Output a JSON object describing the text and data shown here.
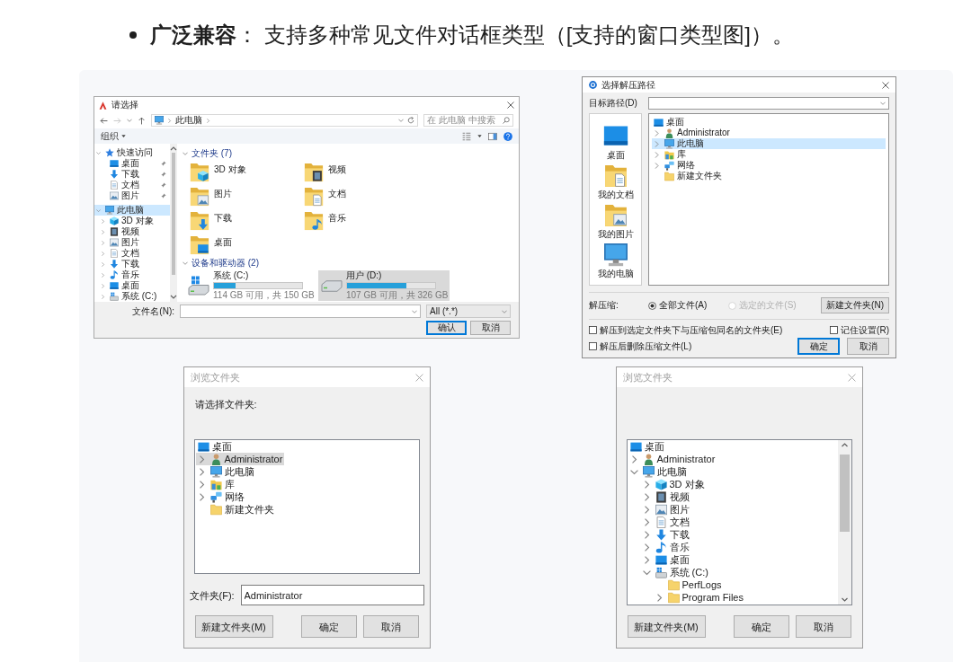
{
  "heading": "**广泛兼容**： 支持多种常见文件对话框类型（[支持的窗口类型图]）。",
  "file_dialog": {
    "title": "请选择",
    "active": true,
    "address": {
      "path": "此电脑"
    },
    "search": {
      "placeholder": "在 此电脑 中搜索"
    },
    "toolbar": {
      "organize": "组织"
    },
    "navigation": [
      {
        "label": "快速访问",
        "kind": "quickaccess",
        "expanded": true,
        "selected": false,
        "children": [
          {
            "label": "桌面",
            "kind": "desktop",
            "leaf": true,
            "expanded": false,
            "selected": false,
            "pinned": true
          },
          {
            "label": "下载",
            "kind": "downloads",
            "leaf": true,
            "expanded": false,
            "selected": false,
            "pinned": true
          },
          {
            "label": "文档",
            "kind": "documents",
            "leaf": true,
            "expanded": false,
            "selected": false,
            "pinned": true
          },
          {
            "label": "图片",
            "kind": "pictures",
            "leaf": true,
            "expanded": false,
            "selected": false,
            "pinned": true
          }
        ]
      },
      {
        "label": "此电脑",
        "kind": "computer",
        "expanded": true,
        "selected": true,
        "children": [
          {
            "label": "3D 对象",
            "kind": "objects3d",
            "expanded": false,
            "selected": false
          },
          {
            "label": "视频",
            "kind": "videos",
            "expanded": false,
            "selected": false
          },
          {
            "label": "图片",
            "kind": "pictures",
            "expanded": false,
            "selected": false
          },
          {
            "label": "文档",
            "kind": "documents",
            "expanded": false,
            "selected": false
          },
          {
            "label": "下载",
            "kind": "downloads",
            "expanded": false,
            "selected": false
          },
          {
            "label": "音乐",
            "kind": "music",
            "expanded": false,
            "selected": false
          },
          {
            "label": "桌面",
            "kind": "desktop",
            "expanded": false,
            "selected": false
          },
          {
            "label": "系统 (C:)",
            "kind": "system",
            "expanded": false,
            "selected": false
          }
        ]
      }
    ],
    "groups": [
      {
        "title": "文件夹 (7)",
        "kind": "folders",
        "expanded": true,
        "items": [
          {
            "label": "3D 对象",
            "kind": "objects3d",
            "selected": false
          },
          {
            "label": "视频",
            "kind": "videos",
            "selected": false
          },
          {
            "label": "图片",
            "kind": "pictures",
            "selected": false
          },
          {
            "label": "文档",
            "kind": "documents",
            "selected": false
          },
          {
            "label": "下载",
            "kind": "downloads",
            "selected": false
          },
          {
            "label": "音乐",
            "kind": "music",
            "selected": false
          },
          {
            "label": "桌面",
            "kind": "desktop",
            "selected": false
          }
        ]
      },
      {
        "title": "设备和驱动器 (2)",
        "kind": "drives",
        "expanded": true,
        "items": [
          {
            "label": "系统 (C:)",
            "kind": "system",
            "selected": false,
            "level": 0.24,
            "reading": "114 GB 可用，共 150 GB"
          },
          {
            "label": "用户 (D:)",
            "kind": "drive",
            "selected": true,
            "level": 0.67,
            "reading": "107 GB 可用，共 326 GB"
          }
        ]
      }
    ],
    "filename": {
      "label": "文件名(N):"
    },
    "filter": {
      "value": "All (*.*)"
    },
    "buttons": [
      {
        "label": "确认",
        "default": true
      },
      {
        "label": "取消",
        "default": false
      }
    ]
  },
  "extract_dialog": {
    "title": "选择解压路径",
    "active": true,
    "target": {
      "label": "目标路径(D)"
    },
    "places": [
      {
        "label": "桌面",
        "kind": "desktop",
        "selected": false
      },
      {
        "label": "我的文档",
        "kind": "documents",
        "selected": false
      },
      {
        "label": "我的图片",
        "kind": "pictures",
        "selected": false
      },
      {
        "label": "我的电脑",
        "kind": "computer",
        "selected": false
      }
    ],
    "tree": [
      {
        "label": "桌面",
        "kind": "desktop",
        "selected": false,
        "children": [
          {
            "label": "Administrator",
            "kind": "user",
            "expanded": false,
            "selected": false
          },
          {
            "label": "此电脑",
            "kind": "computer",
            "expanded": false,
            "selected": true
          },
          {
            "label": "库",
            "kind": "library",
            "expanded": false,
            "selected": false
          },
          {
            "label": "网络",
            "kind": "network",
            "expanded": false,
            "selected": false
          },
          {
            "label": "新建文件夹",
            "kind": "folder",
            "leaf": true,
            "expanded": false,
            "selected": false
          }
        ]
      }
    ],
    "extract": {
      "label": "解压缩:",
      "options": [
        {
          "label": "全部文件(A)",
          "selected": true,
          "disabled": false
        },
        {
          "label": "选定的文件(S)",
          "selected": false,
          "disabled": true
        }
      ]
    },
    "new_folder_button": "新建文件夹(N)",
    "checkboxes": [
      {
        "label": "解压到选定文件夹下与压缩包同名的文件夹(E)",
        "checked": false
      },
      {
        "label": "记住设置(R)",
        "checked": false
      },
      {
        "label": "解压后删除压缩文件(L)",
        "checked": false
      }
    ],
    "buttons": [
      {
        "label": "确定",
        "default": true
      },
      {
        "label": "取消",
        "default": false
      }
    ]
  },
  "browse_dialogs": [
    {
      "title": "浏览文件夹",
      "active": false,
      "prompt": "请选择文件夹:",
      "tree": [
        {
          "label": "桌面",
          "kind": "desktop",
          "selected": false,
          "children": [
            {
              "label": "Administrator",
              "kind": "user",
              "expanded": false,
              "selected": true
            },
            {
              "label": "此电脑",
              "kind": "computer",
              "expanded": false,
              "selected": false
            },
            {
              "label": "库",
              "kind": "library",
              "expanded": false,
              "selected": false
            },
            {
              "label": "网络",
              "kind": "network",
              "expanded": false,
              "selected": false
            },
            {
              "label": "新建文件夹",
              "kind": "folder",
              "leaf": true,
              "expanded": false,
              "selected": false
            }
          ]
        }
      ],
      "folder": {
        "label": "文件夹(F):",
        "value": "Administrator"
      },
      "new_folder_button": "新建文件夹(M)",
      "buttons": [
        {
          "label": "确定",
          "default": false
        },
        {
          "label": "取消",
          "default": false
        }
      ]
    },
    {
      "title": "浏览文件夹",
      "active": false,
      "scrollbar": true,
      "tree": [
        {
          "label": "桌面",
          "kind": "desktop",
          "selected": false,
          "children": [
            {
              "label": "Administrator",
              "kind": "user",
              "expanded": false,
              "selected": false
            },
            {
              "label": "此电脑",
              "kind": "computer",
              "expanded": true,
              "selected": false,
              "children": [
                {
                  "label": "3D 对象",
                  "kind": "objects3d",
                  "expanded": false,
                  "selected": false
                },
                {
                  "label": "视频",
                  "kind": "videos",
                  "expanded": false,
                  "selected": false
                },
                {
                  "label": "图片",
                  "kind": "pictures",
                  "expanded": false,
                  "selected": false
                },
                {
                  "label": "文档",
                  "kind": "documents",
                  "expanded": false,
                  "selected": false
                },
                {
                  "label": "下载",
                  "kind": "downloads",
                  "expanded": false,
                  "selected": false
                },
                {
                  "label": "音乐",
                  "kind": "music",
                  "expanded": false,
                  "selected": false
                },
                {
                  "label": "桌面",
                  "kind": "desktop",
                  "expanded": false,
                  "selected": false
                },
                {
                  "label": "系统 (C:)",
                  "kind": "system",
                  "expanded": true,
                  "selected": false,
                  "children": [
                    {
                      "label": "PerfLogs",
                      "kind": "folder",
                      "leaf": true,
                      "expanded": false,
                      "selected": false
                    },
                    {
                      "label": "Program Files",
                      "kind": "folder",
                      "expanded": false,
                      "selected": false
                    }
                  ]
                }
              ]
            }
          ]
        }
      ],
      "new_folder_button": "新建文件夹(M)",
      "buttons": [
        {
          "label": "确定",
          "default": false
        },
        {
          "label": "取消",
          "default": false
        }
      ]
    }
  ]
}
